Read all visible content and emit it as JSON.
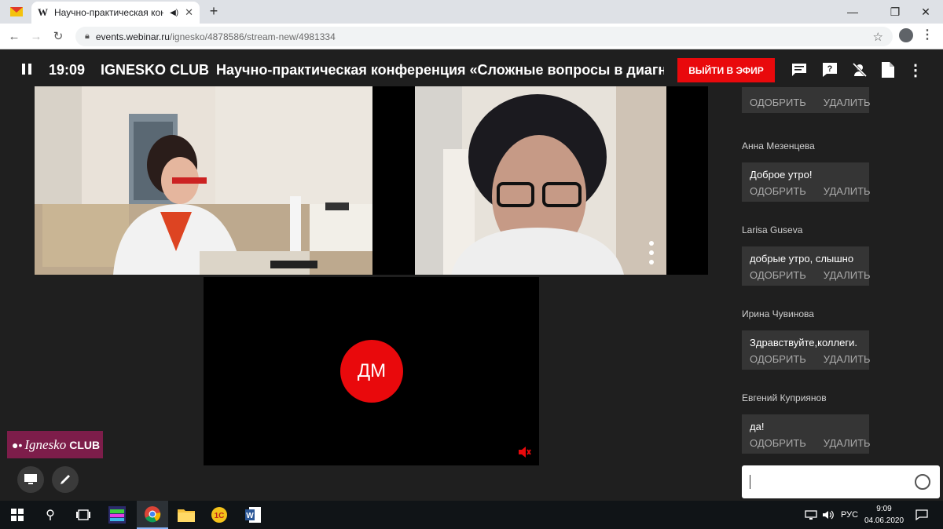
{
  "browser": {
    "tab_title": "Научно-практическая конф",
    "url_host": "events.webinar.ru",
    "url_path": "/ignesko/4878586/stream-new/4981334",
    "tab_new_label": "+"
  },
  "header": {
    "time": "19:09",
    "club": "IGNESKO CLUB",
    "conference_title": "Научно-практическая конференция «Сложные вопросы в диагн...",
    "go_live_label": "ВЫЙТИ В ЭФИР"
  },
  "stage": {
    "avatar_initials": "ДМ",
    "logo_text": "Ignesko",
    "logo_club": "CLUB"
  },
  "chat": {
    "approve_label": "ОДОБРИТЬ",
    "delete_label": "УДАЛИТЬ",
    "messages": [
      {
        "author": "",
        "text": ""
      },
      {
        "author": "Анна Мезенцева",
        "text": "Доброе утро!"
      },
      {
        "author": "Larisa Guseva",
        "text": "добрые утро, слышно"
      },
      {
        "author": "Ирина Чувинова",
        "text": "Здравствуйте,коллеги."
      },
      {
        "author": "Евгений Куприянов",
        "text": "да!"
      }
    ],
    "input_value": ""
  },
  "taskbar": {
    "lang": "РУС",
    "time": "9:09",
    "date": "04.06.2020"
  },
  "colors": {
    "accent_red": "#e9090c",
    "panel_bg": "#1f1f1f",
    "message_bg": "#353535",
    "logo_bg": "#7d1d4a"
  }
}
